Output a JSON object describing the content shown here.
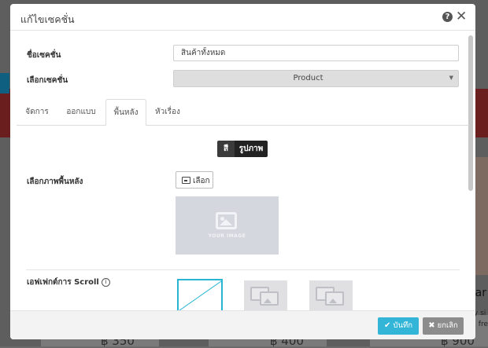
{
  "background": {
    "prices": [
      "฿ 350",
      "฿ 400",
      "฿ 900"
    ],
    "side_text_1": "car",
    "side_text_2": "ly si\na fre"
  },
  "modal": {
    "title": "แก้ไขเซคชั่น",
    "help_icon": "question-circle-icon",
    "close_icon": "close-icon"
  },
  "form": {
    "section_name_label": "ชื่อเซคชั่น",
    "section_name_value": "สินค้าทั้งหมด",
    "section_select_label": "เลือกเซคชั่น",
    "section_select_value": "Product"
  },
  "tabs": [
    {
      "label": "จัดการ",
      "active": false
    },
    {
      "label": "ออกแบบ",
      "active": false
    },
    {
      "label": "พื้นหลัง",
      "active": true
    },
    {
      "label": "หัวเรื่อง",
      "active": false
    }
  ],
  "background_tab": {
    "toggle": [
      "สี",
      "รูปภาพ"
    ],
    "choose_bg_label": "เลือกภาพพื้นหลัง",
    "choose_button": "เลือก",
    "placeholder_text": "YOUR IMAGE",
    "scroll_effect_label": "เอฟเฟกต์การ Scroll",
    "scroll_effect_info": "i"
  },
  "footer": {
    "save": "บันทึก",
    "cancel": "ยกเลิก"
  },
  "colors": {
    "accent": "#33b5d8",
    "cancel": "#8c8c8c"
  }
}
